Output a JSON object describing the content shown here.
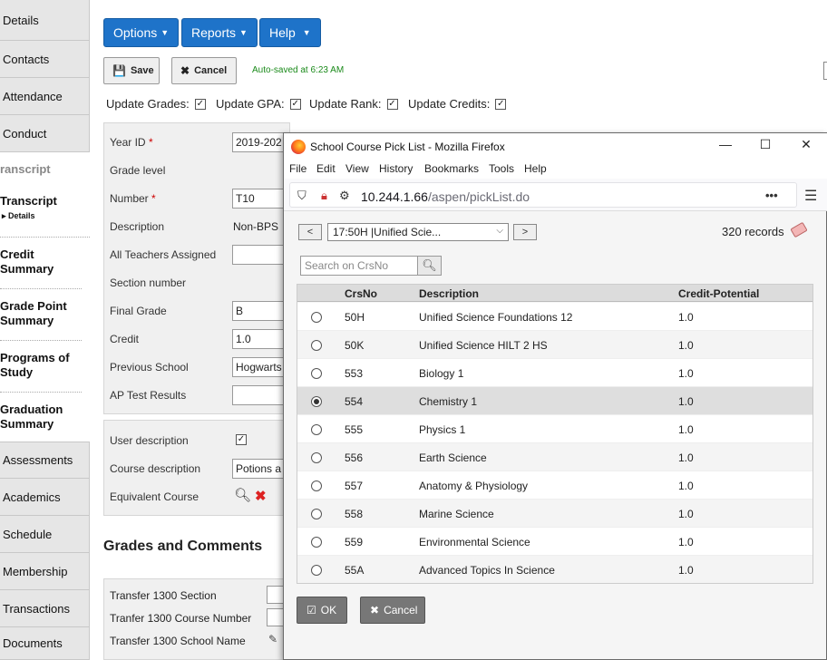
{
  "sidebar": {
    "tabs": [
      {
        "label": "Details"
      },
      {
        "label": "Contacts"
      },
      {
        "label": "Attendance"
      },
      {
        "label": "Conduct"
      }
    ],
    "transcript_header": "ranscript",
    "subitems": [
      {
        "label": "Transcript",
        "sub": "▸ Details"
      },
      {
        "label": "Credit Summary"
      },
      {
        "label": "Grade Point Summary"
      },
      {
        "label": "Programs of Study"
      },
      {
        "label": "Graduation Summary"
      }
    ],
    "bottom_tabs": [
      {
        "label": "Assessments"
      },
      {
        "label": "Academics"
      },
      {
        "label": "Schedule"
      },
      {
        "label": "Membership"
      },
      {
        "label": "Transactions"
      },
      {
        "label": "Documents"
      }
    ]
  },
  "menus": {
    "options": "Options",
    "reports": "Reports",
    "help": "Help"
  },
  "toolbar": {
    "save": "Save",
    "cancel": "Cancel",
    "autosave": "Auto-saved at 6:23 AM"
  },
  "updates": {
    "grades": "Update Grades:",
    "gpa": "Update GPA:",
    "rank": "Update Rank:",
    "credits": "Update Credits:"
  },
  "form": {
    "year_id_label": "Year ID",
    "year_id_value": "2019-202",
    "grade_level_label": "Grade level",
    "number_label": "Number",
    "number_value": "T10",
    "description_label": "Description",
    "description_value": "Non-BPS",
    "all_teachers_label": "All Teachers Assigned",
    "section_number_label": "Section number",
    "final_grade_label": "Final Grade",
    "final_grade_value": "B",
    "credit_label": "Credit",
    "credit_value": "1.0",
    "previous_school_label": "Previous School",
    "previous_school_value": "Hogwarts",
    "ap_test_label": "AP Test Results",
    "required_mark": "*",
    "user_desc_label": "User description",
    "course_desc_label": "Course description",
    "course_desc_value": "Potions a",
    "equiv_course_label": "Equivalent Course"
  },
  "grades_section": {
    "title": "Grades and Comments",
    "transfer_section": "Transfer 1300 Section",
    "transfer_course_number": "Tranfer 1300 Course Number",
    "transfer_school_name": "Transfer 1300 School Name"
  },
  "popup": {
    "title": "School Course Pick List - Mozilla Firefox",
    "menubar": [
      "File",
      "Edit",
      "View",
      "History",
      "Bookmarks",
      "Tools",
      "Help"
    ],
    "url_host": "10.244.1.66",
    "url_path": "/aspen/pickList.do",
    "prev": "<",
    "next": ">",
    "selected_course": "17:50H |Unified Scie...",
    "records": "320 records",
    "search_placeholder": "Search on CrsNo",
    "columns": {
      "crsno": "CrsNo",
      "description": "Description",
      "credit": "Credit-Potential"
    },
    "rows": [
      {
        "crsno": "50H",
        "description": "Unified Science Foundations 12",
        "credit": "1.0",
        "selected": false
      },
      {
        "crsno": "50K",
        "description": "Unified Science HILT 2 HS",
        "credit": "1.0",
        "selected": false
      },
      {
        "crsno": "553",
        "description": "Biology 1",
        "credit": "1.0",
        "selected": false
      },
      {
        "crsno": "554",
        "description": "Chemistry 1",
        "credit": "1.0",
        "selected": true
      },
      {
        "crsno": "555",
        "description": "Physics 1",
        "credit": "1.0",
        "selected": false
      },
      {
        "crsno": "556",
        "description": "Earth Science",
        "credit": "1.0",
        "selected": false
      },
      {
        "crsno": "557",
        "description": "Anatomy & Physiology",
        "credit": "1.0",
        "selected": false
      },
      {
        "crsno": "558",
        "description": "Marine Science",
        "credit": "1.0",
        "selected": false
      },
      {
        "crsno": "559",
        "description": "Environmental Science",
        "credit": "1.0",
        "selected": false
      },
      {
        "crsno": "55A",
        "description": "Advanced Topics In Science",
        "credit": "1.0",
        "selected": false
      }
    ],
    "ok": "OK",
    "cancel": "Cancel"
  }
}
